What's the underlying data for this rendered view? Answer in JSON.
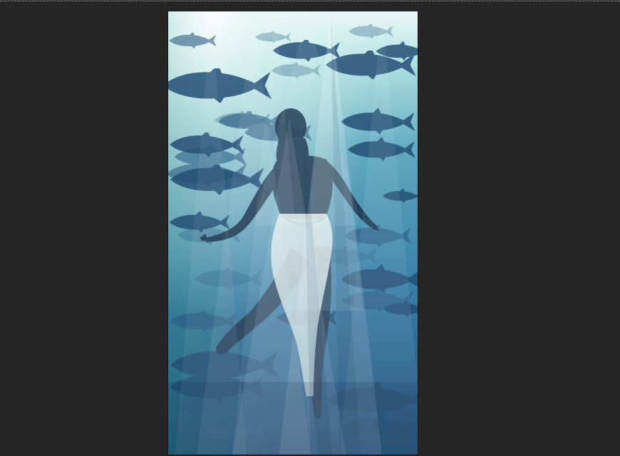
{
  "canvas": {
    "background_color": "#262626",
    "document": {
      "content_type": "underwater-photo-with-light-rays",
      "palette": {
        "water_top": "#cfeff0",
        "water_mid": "#4c9fb7",
        "water_bottom": "#1e4f79",
        "fish": "#254e74",
        "swimmer": "#1d3952",
        "dress": "#d4e3e2",
        "rays": "#ffffff"
      }
    }
  }
}
